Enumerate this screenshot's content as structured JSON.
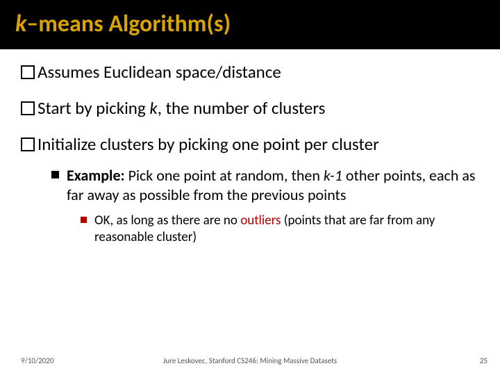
{
  "title": {
    "k": "k",
    "rest": "–means Algorithm(s)"
  },
  "bullets": {
    "b1": {
      "word1": "Assumes",
      "rest": " Euclidean space/distance"
    },
    "b2": {
      "word1": "Start",
      "rest1": " by picking ",
      "k": "k",
      "rest2": ", the number of clusters"
    },
    "b3": {
      "word1": "Initialize",
      "rest": " clusters by picking one point per cluster"
    }
  },
  "example": {
    "label": "Example:",
    "text1": " Pick one point at random, then  ",
    "k1": "k-1",
    "text2": " other points, each as far away as possible from the previous points"
  },
  "sub": {
    "pre": "OK, as long as there are no ",
    "outliers": "outliers",
    "post": " (points that are far from any reasonable cluster)"
  },
  "footer": {
    "date": "9/10/2020",
    "mid": "Jure Leskovec, Stanford CS246: Mining Massive Datasets",
    "page": "25"
  }
}
